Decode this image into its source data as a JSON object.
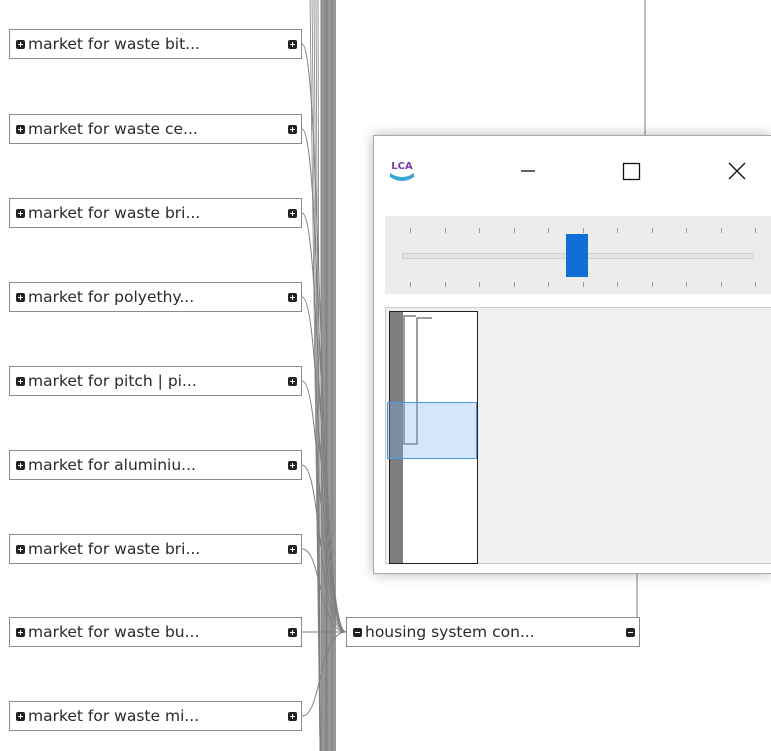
{
  "graph": {
    "input_nodes": [
      {
        "label": "market for waste bit...",
        "expand_icon": "plus-box-icon"
      },
      {
        "label": "market for waste ce...",
        "expand_icon": "plus-box-icon"
      },
      {
        "label": "market for waste bri...",
        "expand_icon": "plus-box-icon"
      },
      {
        "label": "market for polyethy...",
        "expand_icon": "plus-box-icon"
      },
      {
        "label": "market for pitch | pi...",
        "expand_icon": "plus-box-icon"
      },
      {
        "label": "market for aluminiu...",
        "expand_icon": "plus-box-icon"
      },
      {
        "label": "market for waste bri...",
        "expand_icon": "plus-box-icon"
      },
      {
        "label": "market for waste bu...",
        "expand_icon": "plus-box-icon"
      },
      {
        "label": "market for waste mi...",
        "expand_icon": "plus-box-icon"
      }
    ],
    "target_node": {
      "label": "housing system con...",
      "collapse_icon": "minus-box-icon"
    },
    "edge_color": "#7f7f7f"
  },
  "overview_window": {
    "logo_text": "LCA",
    "logo_icon": "openlca-logo-icon",
    "controls": {
      "minimize_icon": "minimize-icon",
      "maximize_icon": "maximize-icon",
      "close_icon": "close-icon"
    },
    "zoom_slider": {
      "value_fraction": 0.5,
      "accent": "#0f6fd6"
    },
    "preview": {
      "viewport_color": "#4a9ae8"
    }
  }
}
